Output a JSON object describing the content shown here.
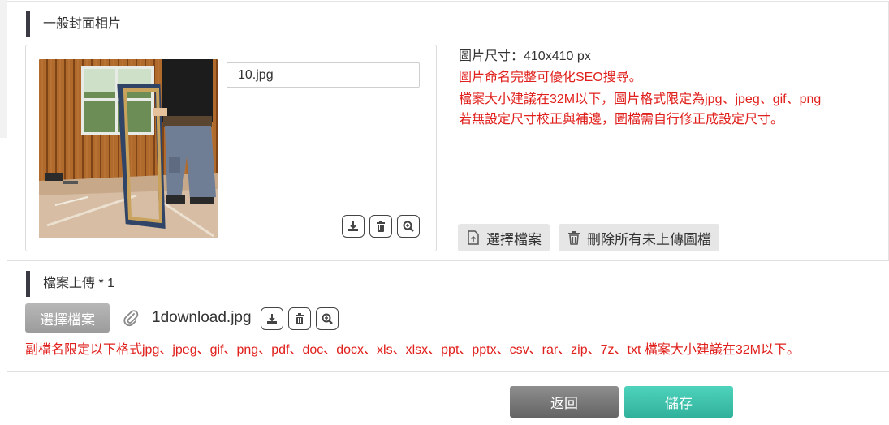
{
  "cover_section": {
    "title": "一般封面相片",
    "filename": "10.jpg",
    "actions": [
      "download-icon",
      "trash-icon",
      "zoom-in-icon"
    ],
    "info": {
      "size_line": "圖片尺寸：410x410 px",
      "notes": [
        "圖片命名完整可優化SEO搜尋。",
        "檔案大小建議在32M以下，圖片格式限定為jpg、jpeg、gif、png",
        "若無設定尺寸校正與補邊，圖檔需自行修正成設定尺寸。"
      ]
    },
    "choose_file_label": "選擇檔案",
    "delete_unuploaded_label": "刪除所有未上傳圖檔"
  },
  "upload_section": {
    "title": "檔案上傳 * 1",
    "choose_file_label": "選擇檔案",
    "attachment_name": "1download.jpg",
    "notice": "副檔名限定以下格式jpg、jpeg、gif、png、pdf、doc、docx、xls、xlsx、ppt、pptx、csv、rar、zip、7z、txt 檔案大小建議在32M以下。"
  },
  "footer": {
    "back_label": "返回",
    "save_label": "儲存"
  },
  "colors": {
    "warning_text": "#e0201c",
    "save_button": "#38bda6",
    "back_button": "#777777",
    "section_marker": "#3a3a44"
  }
}
